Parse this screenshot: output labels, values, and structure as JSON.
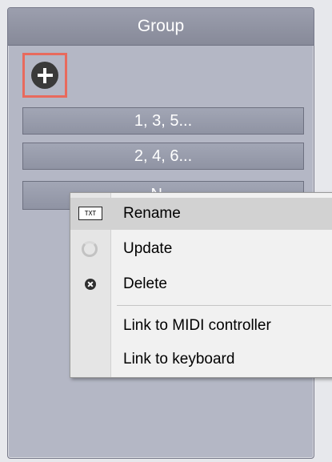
{
  "panel": {
    "title": "Group",
    "add_icon": "plus-circle-icon",
    "groups": [
      {
        "label": "1, 3, 5..."
      },
      {
        "label": "2, 4, 6..."
      },
      {
        "label": "N..."
      }
    ]
  },
  "context_menu": {
    "items": [
      {
        "label": "Rename",
        "icon": "rename-icon",
        "highlighted": true
      },
      {
        "label": "Update",
        "icon": "update-icon",
        "disabled_look": true
      },
      {
        "label": "Delete",
        "icon": "delete-icon"
      },
      {
        "label": "Link to MIDI controller"
      },
      {
        "label": "Link to keyboard"
      }
    ]
  },
  "colors": {
    "panel_bg": "#b4b7c5",
    "header_bg": "#9c9fae",
    "highlight_border": "#e86a5d",
    "menu_bg": "#f1f1f1",
    "menu_highlight": "#d2d2d2"
  }
}
